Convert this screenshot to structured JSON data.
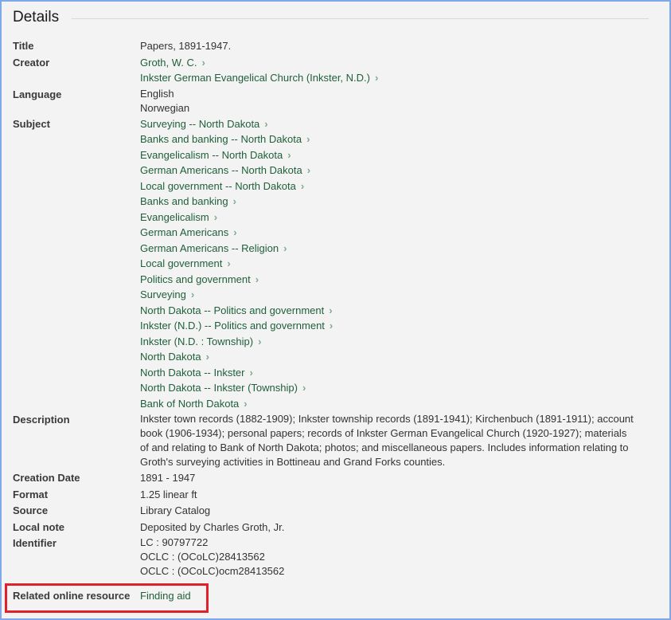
{
  "section": {
    "title": "Details"
  },
  "fields": {
    "title": {
      "label": "Title",
      "value": "Papers, 1891-1947."
    },
    "creator": {
      "label": "Creator",
      "links": [
        "Groth, W. C.",
        "Inkster German Evangelical Church (Inkster, N.D.)"
      ]
    },
    "language": {
      "label": "Language",
      "values": [
        "English",
        "Norwegian"
      ]
    },
    "subject": {
      "label": "Subject",
      "links": [
        "Surveying -- North Dakota",
        "Banks and banking -- North Dakota",
        "Evangelicalism -- North Dakota",
        "German Americans -- North Dakota",
        "Local government -- North Dakota",
        "Banks and banking",
        "Evangelicalism",
        "German Americans",
        "German Americans -- Religion",
        "Local government",
        "Politics and government",
        "Surveying",
        "North Dakota -- Politics and government",
        "Inkster (N.D.) -- Politics and government",
        "Inkster (N.D. : Township)",
        "North Dakota",
        "North Dakota -- Inkster",
        "North Dakota -- Inkster (Township)",
        "Bank of North Dakota"
      ]
    },
    "description": {
      "label": "Description",
      "value": "Inkster town records (1882-1909); Inkster township records (1891-1941); Kirchenbuch (1891-1911); account book (1906-1934); personal papers; records of Inkster German Evangelical Church (1920-1927); materials of and relating to Bank of North Dakota; photos; and miscellaneous papers. Includes information relating to Groth's surveying activities in Bottineau and Grand Forks counties."
    },
    "creation_date": {
      "label": "Creation Date",
      "value": "1891 - 1947"
    },
    "format": {
      "label": "Format",
      "value": "1.25 linear ft"
    },
    "source": {
      "label": "Source",
      "value": "Library Catalog"
    },
    "local_note": {
      "label": "Local note",
      "value": "Deposited by Charles Groth, Jr."
    },
    "identifier": {
      "label": "Identifier",
      "values": [
        "LC : 90797722",
        "OCLC : (OCoLC)28413562",
        "OCLC : (OCoLC)ocm28413562"
      ]
    },
    "related_online_resource": {
      "label": "Related online resource",
      "link": "Finding aid"
    }
  },
  "icons": {
    "chevron": "›"
  },
  "colors": {
    "link": "#1f5f3a",
    "chevron": "#7faa8f",
    "frame_border": "#7fa8e8",
    "highlight": "#e0202a"
  }
}
